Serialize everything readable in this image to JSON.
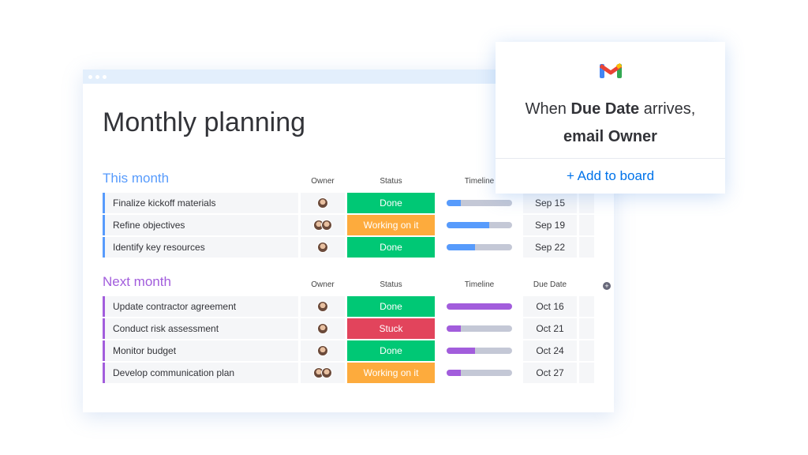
{
  "board": {
    "title": "Monthly planning"
  },
  "columns": {
    "owner": "Owner",
    "status": "Status",
    "timeline": "Timeline",
    "due": "Due Date"
  },
  "colors": {
    "done": "#00c875",
    "working": "#fdab3d",
    "stuck": "#e2445c",
    "this_month": "#579bfc",
    "next_month": "#a25ddc"
  },
  "groups": [
    {
      "title": "This month",
      "color": "#579bfc",
      "show_due_header": false,
      "rows": [
        {
          "name": "Finalize kickoff materials",
          "owners": 1,
          "status": "Done",
          "status_color": "#00c875",
          "timeline": 0.22,
          "due": "Sep 15"
        },
        {
          "name": "Refine objectives",
          "owners": 2,
          "status": "Working on it",
          "status_color": "#fdab3d",
          "timeline": 0.65,
          "due": "Sep 19"
        },
        {
          "name": "Identify key resources",
          "owners": 1,
          "status": "Done",
          "status_color": "#00c875",
          "timeline": 0.43,
          "due": "Sep 22"
        }
      ]
    },
    {
      "title": "Next month",
      "color": "#a25ddc",
      "show_due_header": true,
      "rows": [
        {
          "name": "Update contractor agreement",
          "owners": 1,
          "status": "Done",
          "status_color": "#00c875",
          "timeline": 1.0,
          "due": "Oct 16"
        },
        {
          "name": "Conduct risk assessment",
          "owners": 1,
          "status": "Stuck",
          "status_color": "#e2445c",
          "timeline": 0.22,
          "due": "Oct 21"
        },
        {
          "name": "Monitor budget",
          "owners": 1,
          "status": "Done",
          "status_color": "#00c875",
          "timeline": 0.43,
          "due": "Oct 24"
        },
        {
          "name": "Develop communication plan",
          "owners": 2,
          "status": "Working on it",
          "status_color": "#fdab3d",
          "timeline": 0.22,
          "due": "Oct 27"
        }
      ]
    }
  ],
  "popup": {
    "icon": "gmail-icon",
    "line1_pre": "When ",
    "line1_bold": "Due Date",
    "line1_post": " arrives,",
    "line2_bold": "email Owner",
    "button": "+ Add to board"
  }
}
